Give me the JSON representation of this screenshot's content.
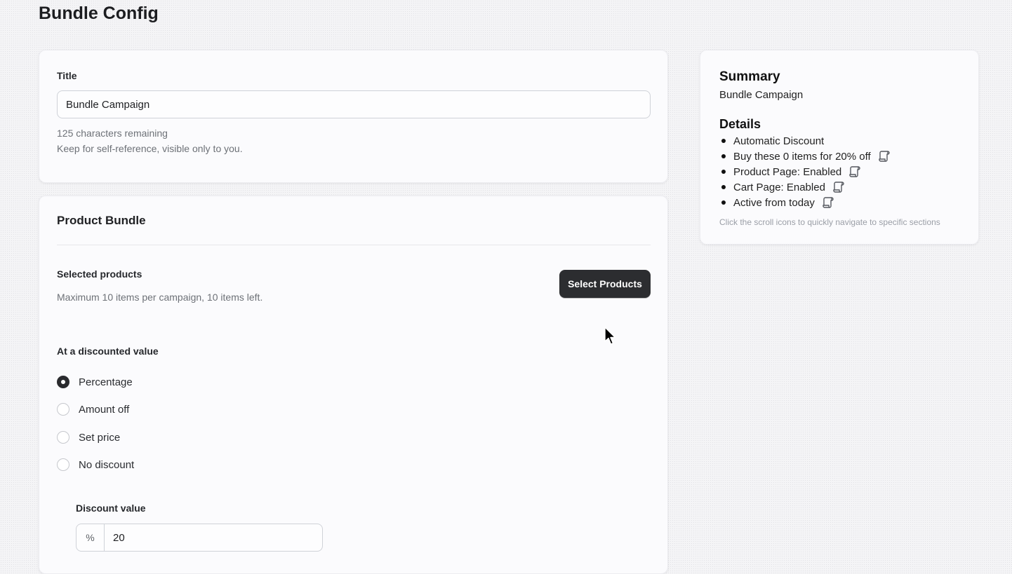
{
  "page": {
    "title": "Bundle Config"
  },
  "title_card": {
    "label": "Title",
    "value": "Bundle Campaign",
    "remaining": "125 characters remaining",
    "hint": "Keep for self-reference, visible only to you."
  },
  "bundle_card": {
    "title": "Product Bundle",
    "selected_label": "Selected products",
    "selected_hint": "Maximum 10 items per campaign, 10 items left.",
    "select_button": "Select Products",
    "discount_label": "At a discounted value",
    "options": [
      {
        "label": "Percentage",
        "checked": true
      },
      {
        "label": "Amount off",
        "checked": false
      },
      {
        "label": "Set price",
        "checked": false
      },
      {
        "label": "No discount",
        "checked": false
      }
    ],
    "discount_value_label": "Discount value",
    "discount_prefix": "%",
    "discount_value": "20"
  },
  "summary": {
    "title": "Summary",
    "campaign": "Bundle Campaign",
    "details_title": "Details",
    "items": [
      {
        "text": "Automatic Discount",
        "icon": null
      },
      {
        "text": "Buy these 0 items for 20% off",
        "icon": "scroll-icon"
      },
      {
        "text": "Product Page: Enabled",
        "icon": "scroll-icon"
      },
      {
        "text": "Cart Page: Enabled",
        "icon": "scroll-icon"
      },
      {
        "text": "Active from today",
        "icon": "scroll-icon"
      }
    ],
    "hint": "Click the scroll icons to quickly navigate to specific sections"
  },
  "colors": {
    "accent_dark": "#2c2d30",
    "card_bg": "#fbfbfd",
    "muted_text": "#6d7177"
  }
}
